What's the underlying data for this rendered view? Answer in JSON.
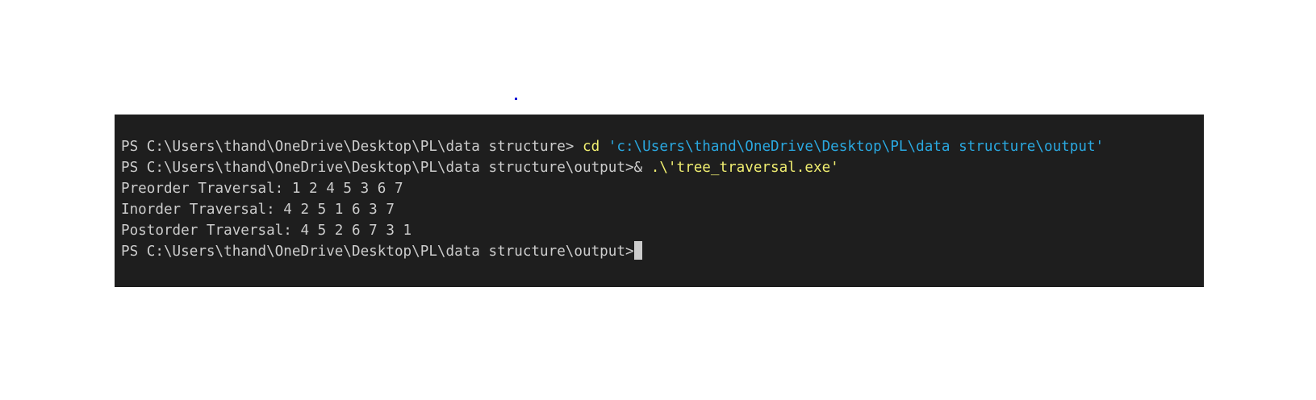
{
  "terminal": {
    "lines": {
      "line1": {
        "prompt": "PS C:\\Users\\thand\\OneDrive\\Desktop\\PL\\data structure> ",
        "command": "cd",
        "argument": " 'c:\\Users\\thand\\OneDrive\\Desktop\\PL\\data structure\\output'"
      },
      "line2": {
        "prompt": "PS C:\\Users\\thand\\OneDrive\\Desktop\\PL\\data structure\\output>& ",
        "command": ".\\'tree_traversal.exe'"
      },
      "line3": "Preorder Traversal: 1 2 4 5 3 6 7",
      "line4": "Inorder Traversal: 4 2 5 1 6 3 7",
      "line5": "Postorder Traversal: 4 5 2 6 7 3 1",
      "line6": {
        "prompt": "PS C:\\Users\\thand\\OneDrive\\Desktop\\PL\\data structure\\output>"
      }
    },
    "colors": {
      "background": "#1e1e1e",
      "text": "#cccccc",
      "command_yellow": "#f0ee70",
      "string_blue": "#2aa8e0"
    }
  }
}
